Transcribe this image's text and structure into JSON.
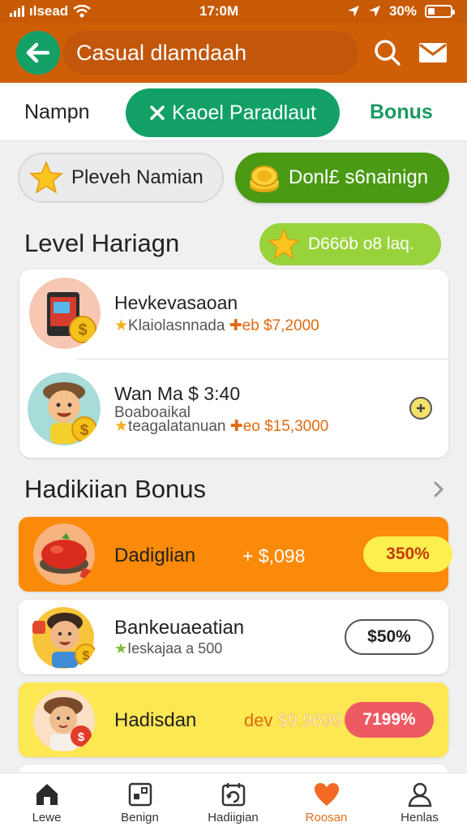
{
  "status_bar": {
    "carrier": "ılsead",
    "time": "17:0M",
    "battery": "30%",
    "battery_level": 0.3
  },
  "header": {
    "title": "Casual dlamdaah"
  },
  "tabs": [
    {
      "label": "Nampn"
    },
    {
      "label": "Kaoel Paradlaut",
      "active": true
    },
    {
      "label": "Bonus"
    }
  ],
  "chips": [
    {
      "label": "Pleveh Namian"
    },
    {
      "label": "Donl£ s6nainign"
    }
  ],
  "level": {
    "title": "Level Hariagn",
    "pill_label": "D66öb o8 laq.",
    "rows": [
      {
        "name": "Hevkevasaoan",
        "sub_prefix": "Klaiolasnnada",
        "sub_amount": "✚eb $7,2000"
      },
      {
        "name": "Wan Ma $ 3:40",
        "line2": "Boaboaikal",
        "sub_prefix": "teagalatanuan",
        "sub_amount": "✚eo $15,3000"
      }
    ]
  },
  "bonus": {
    "title": "Hadikiian Bonus",
    "items": [
      {
        "name": "Dadiglian",
        "price": "+ $,098",
        "badge": "350%"
      },
      {
        "name": "Bankeuaeatian",
        "sub": "Ieskajaa a 500",
        "badge": "$50%"
      },
      {
        "name": "Hadisdan",
        "price_prefix": "dev",
        "price": "$9.9699",
        "badge": "7199%"
      }
    ]
  },
  "bottom_nav": [
    {
      "label": "Lewe"
    },
    {
      "label": "Benign"
    },
    {
      "label": "Hadiigian"
    },
    {
      "label": "Roosan",
      "active": true
    },
    {
      "label": "Henlas"
    }
  ],
  "colors": {
    "header": "#cf5f07",
    "green": "#12a067",
    "orange_accent": "#e06a10",
    "bonus_orange": "#fb8a08",
    "bonus_yellow": "#fde752"
  }
}
